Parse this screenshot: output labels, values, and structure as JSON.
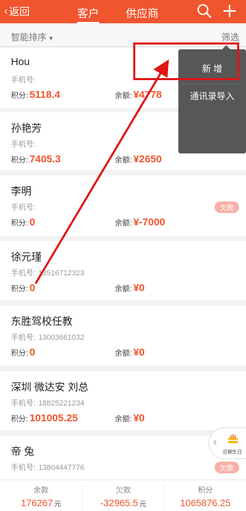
{
  "header": {
    "back_label": "返回",
    "tabs": [
      {
        "label": "客户",
        "active": true
      },
      {
        "label": "供应商",
        "active": false
      }
    ],
    "icons": [
      "search-icon",
      "plus-icon"
    ],
    "accent": "#f0552e"
  },
  "filterbar": {
    "sort_label": "智能排序",
    "filter_label": "筛选"
  },
  "customers": [
    {
      "name": "Hou",
      "phone_label": "手机号:",
      "phone": "",
      "points_label": "积分:",
      "points": "5118.4",
      "balance_label": "余额:",
      "balance": "¥4778",
      "badge": ""
    },
    {
      "name": "孙艳芳",
      "phone_label": "手机号:",
      "phone": "",
      "points_label": "积分:",
      "points": "7405.3",
      "balance_label": "余额:",
      "balance": "¥2650",
      "badge": ""
    },
    {
      "name": "李明",
      "phone_label": "手机号:",
      "phone": "",
      "points_label": "积分:",
      "points": "0",
      "balance_label": "余额:",
      "balance": "¥-7000",
      "badge": "欠款"
    },
    {
      "name": "徐元瑾",
      "phone_label": "手机号:",
      "phone": "13516712323",
      "points_label": "积分:",
      "points": "0",
      "balance_label": "余额:",
      "balance": "¥0",
      "badge": ""
    },
    {
      "name": "东胜驾校任教",
      "phone_label": "手机号:",
      "phone": "13003661032",
      "points_label": "积分:",
      "points": "0",
      "balance_label": "余额:",
      "balance": "¥0",
      "badge": ""
    },
    {
      "name": "深圳 微达安 刘总",
      "phone_label": "手机号:",
      "phone": "18825221234",
      "points_label": "积分:",
      "points": "101005.25",
      "balance_label": "余额:",
      "balance": "¥0",
      "badge": ""
    },
    {
      "name": "帝 兔",
      "phone_label": "手机号:",
      "phone": "13804447776",
      "points_label": "积分:",
      "points": "",
      "balance_label": "余额:",
      "balance": "",
      "badge": "欠款"
    }
  ],
  "popup_menu": {
    "items": [
      "新 增",
      "通讯录导入"
    ]
  },
  "birthday_widget": {
    "label": "近期生日",
    "icon": "cake-icon"
  },
  "summary": {
    "balance_label": "余款",
    "balance_value": "176267",
    "debt_label": "欠款",
    "debt_value": "-32965.5",
    "points_label": "积分",
    "points_value": "1065876.25",
    "unit": "元"
  }
}
